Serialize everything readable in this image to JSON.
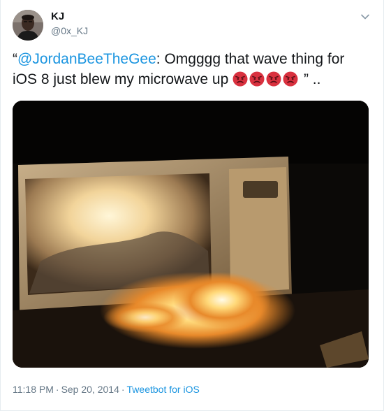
{
  "author": {
    "name": "KJ",
    "handle": "@0x_KJ"
  },
  "tweet": {
    "open_quote": "“",
    "mention": "@JordanBeeTheGee",
    "text": ": Omgggg that wave thing for iOS 8 just blew my microwave up ",
    "emojis": [
      "angry-face",
      "angry-face",
      "angry-face",
      "angry-face"
    ],
    "close_quote": " ” .."
  },
  "meta": {
    "time": "11:18 PM",
    "separator": "·",
    "date": "Sep 20, 2014",
    "source": "Tweetbot for iOS"
  },
  "colors": {
    "link": "#1b95e0",
    "muted": "#657786",
    "text": "#14171a",
    "emoji": "#d9313f"
  },
  "icons": {
    "menu": "chevron-down-icon",
    "emoji": "angry-face-icon"
  }
}
